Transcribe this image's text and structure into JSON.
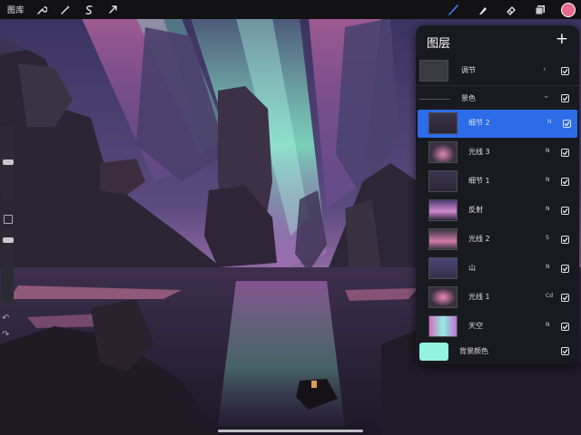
{
  "toolbar": {
    "gallery_label": "图库",
    "tools_left": [
      "wrench-icon",
      "magic-wand-icon",
      "selection-icon",
      "transform-arrow-icon"
    ],
    "tools_right": [
      "brush-icon",
      "smudge-icon",
      "eraser-icon",
      "layers-icon"
    ],
    "current_color": "#e86a8c",
    "active_tool_color": "#3b82f6"
  },
  "sidebar": {
    "undo_glyph": "↶",
    "redo_glyph": "↷"
  },
  "layers_panel": {
    "title": "图层",
    "add_glyph": "+",
    "group_adjust": {
      "name": "调节",
      "chevron": "›"
    },
    "group_scene": {
      "name": "景色",
      "chevron": "⌄"
    },
    "layers": [
      {
        "name": "细节 2",
        "blend": "N",
        "selected": true
      },
      {
        "name": "光线 3",
        "blend": "N"
      },
      {
        "name": "细节 1",
        "blend": "N"
      },
      {
        "name": "反射",
        "blend": "N"
      },
      {
        "name": "光线 2",
        "blend": "S"
      },
      {
        "name": "山",
        "blend": "N"
      },
      {
        "name": "光线 1",
        "blend": "Cd"
      },
      {
        "name": "天空",
        "blend": "N"
      }
    ],
    "background": {
      "name": "背景颜色",
      "color": "#93f3df"
    },
    "selected_color": "#2c6ce8"
  }
}
